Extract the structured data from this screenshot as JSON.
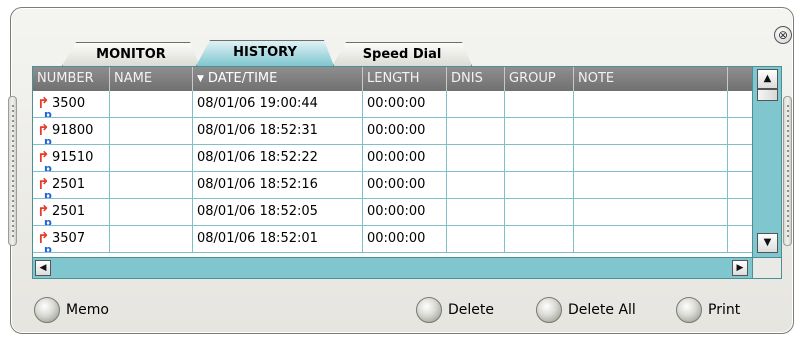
{
  "window": {
    "close_symbol": "⊗"
  },
  "tabs": [
    {
      "label": "MONITOR",
      "active": false
    },
    {
      "label": "HISTORY",
      "active": true
    },
    {
      "label": "Speed Dial",
      "active": false
    }
  ],
  "grid": {
    "columns": [
      "NUMBER",
      "NAME",
      "DATE/TIME",
      "LENGTH",
      "DNIS",
      "GROUP",
      "NOTE"
    ],
    "sorted_column": "DATE/TIME",
    "sort_indicator": "▼",
    "rows": [
      {
        "icon": "outgoing-call-p-icon",
        "number": "3500",
        "name": "",
        "datetime": "08/01/06 19:00:44",
        "length": "00:00:00",
        "dnis": "",
        "group": "",
        "note": ""
      },
      {
        "icon": "outgoing-call-p-icon",
        "number": "91800",
        "name": "",
        "datetime": "08/01/06 18:52:31",
        "length": "00:00:00",
        "dnis": "",
        "group": "",
        "note": ""
      },
      {
        "icon": "outgoing-call-p-icon",
        "number": "91510",
        "name": "",
        "datetime": "08/01/06 18:52:22",
        "length": "00:00:00",
        "dnis": "",
        "group": "",
        "note": ""
      },
      {
        "icon": "outgoing-call-p-icon",
        "number": "2501",
        "name": "",
        "datetime": "08/01/06 18:52:16",
        "length": "00:00:00",
        "dnis": "",
        "group": "",
        "note": ""
      },
      {
        "icon": "outgoing-call-p-icon",
        "number": "2501",
        "name": "",
        "datetime": "08/01/06 18:52:05",
        "length": "00:00:00",
        "dnis": "",
        "group": "",
        "note": ""
      },
      {
        "icon": "outgoing-call-p-icon",
        "number": "3507",
        "name": "",
        "datetime": "08/01/06 18:52:01",
        "length": "00:00:00",
        "dnis": "",
        "group": "",
        "note": ""
      }
    ]
  },
  "buttons": {
    "memo": "Memo",
    "delete": "Delete",
    "delete_all": "Delete All",
    "print": "Print"
  },
  "colors": {
    "accent": "#7fc6cf",
    "header": "#7d7d7d",
    "call_arrow": "#e53b2a",
    "call_p": "#1f63d6"
  }
}
